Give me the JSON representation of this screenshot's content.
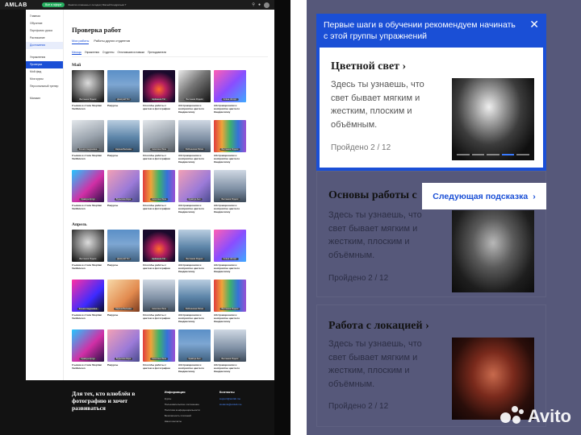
{
  "left": {
    "header": {
      "logo": "AMLAB",
      "pill": "Все в эфире",
      "note": "Занятия отменены с сегодня | Малый Кондратьев ?"
    },
    "sidebar": {
      "top_items": [
        "Главная",
        "Обучение",
        "Портфолио урока",
        "Расписание",
        "Достижения"
      ],
      "sub_items": [
        "Упражнения",
        "Проверка",
        "Мой фид",
        "Мои курсы",
        "Персональный тренер"
      ],
      "bottom_items": [
        "Магазин"
      ]
    },
    "page_title": "Проверка работ",
    "tabs": [
      "Мои работы",
      "Работы других студентов"
    ],
    "filters": [
      "Месяцы",
      "Упражнения",
      "Студенты",
      "Отличившиеся навыки",
      "Преподаватели"
    ],
    "months": [
      "Май",
      "Апрель"
    ],
    "captions": [
      "Съемка в стиле Stephan Vanfleteren",
      "Ракурсы",
      "Способы работы с цветом в фотографии",
      "Абстракционизм и восприятие цвета по Кандинскому",
      "Абстракционизм и восприятие цвета по Кандинскому"
    ],
    "footer": {
      "hero": "Для тех, кто влюблён в фотографию и хочет развиваться",
      "info_title": "Информация",
      "info_links": [
        "Курсы",
        "Пользовательское соглашение",
        "Политика конфиденциальности",
        "Безопасность платежей",
        "Наши контакты"
      ],
      "contacts_title": "Контакты",
      "contacts": [
        "support@amlab.me",
        "students@amlab.me"
      ]
    }
  },
  "right": {
    "tip": "Первые шаги в обучении рекомендуем начинать с этой группы упражнений",
    "exercises": [
      {
        "title": "Цветной свет",
        "desc": "Здесь ты узнаешь, что свет бывает мягким и жестким, плоским и объёмным.",
        "progress": "Пройдено 2 / 12"
      },
      {
        "title": "Основы работы с",
        "desc": "Здесь ты узнаешь, что свет бывает мягким и жестким, плоским и объёмным.",
        "progress": "Пройдено 2 / 12"
      },
      {
        "title": "Работа с локацией",
        "desc": "Здесь ты узнаешь, что свет бывает мягким и жестким, плоским и объёмным.",
        "progress": "Пройдено 2 / 12"
      }
    ],
    "next_hint": "Следующая подсказка",
    "watermark": "Avito"
  }
}
